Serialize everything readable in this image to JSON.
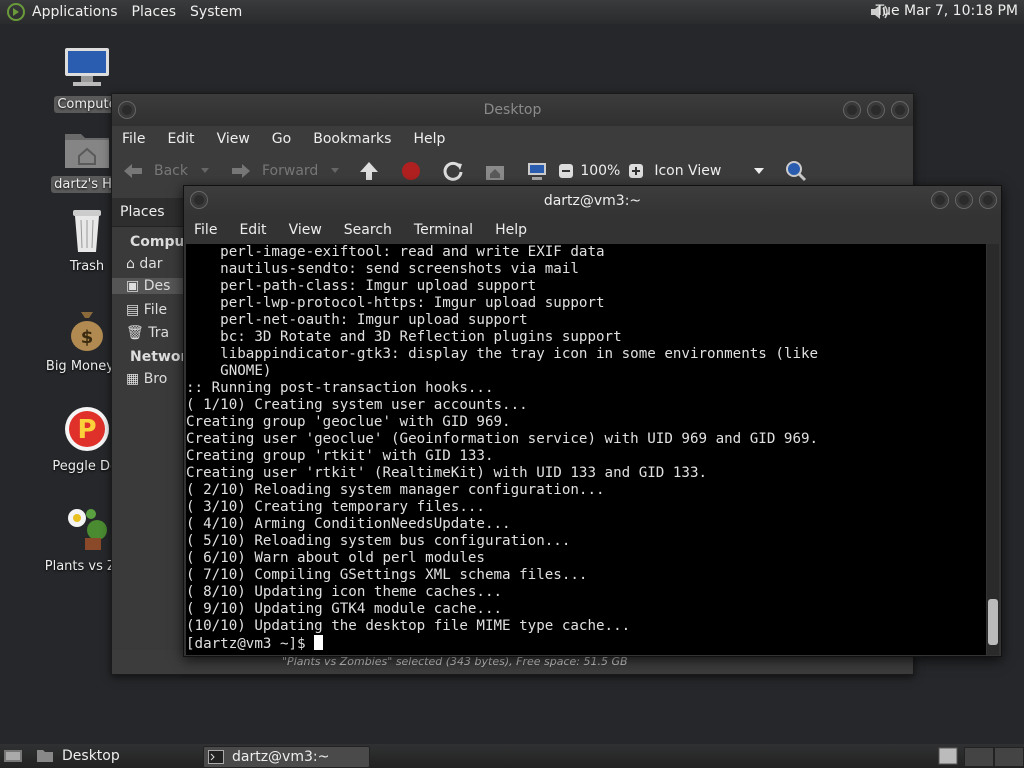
{
  "top_panel": {
    "menus": [
      "Applications",
      "Places",
      "System"
    ],
    "clock": "Tue Mar  7, 10:18 PM"
  },
  "desktop_icons": [
    {
      "label": "Compute",
      "icon": "computer-icon",
      "selected": true
    },
    {
      "label": "dartz's Ho",
      "icon": "home-folder-icon",
      "selected": true
    },
    {
      "label": "Trash",
      "icon": "trash-icon",
      "selected": false
    },
    {
      "label": "Big Money D",
      "icon": "money-bag-icon",
      "selected": false
    },
    {
      "label": "Peggle Del",
      "icon": "peggle-icon",
      "selected": false
    },
    {
      "label": "Plants vs Zor",
      "icon": "plants-vs-zombies-icon",
      "selected": false
    }
  ],
  "nautilus": {
    "title": "Desktop",
    "menus": [
      "File",
      "Edit",
      "View",
      "Go",
      "Bookmarks",
      "Help"
    ],
    "toolbar": {
      "back": "Back",
      "forward": "Forward",
      "zoom": "100%",
      "view_mode": "Icon View"
    },
    "places_label": "Places",
    "sidebar": {
      "computer_header": "Compute",
      "items": [
        "dar",
        "Des",
        "File",
        "Tra"
      ],
      "network_header": "Network",
      "network_items": [
        "Bro"
      ]
    },
    "status": "\"Plants vs Zombies\" selected (343 bytes), Free space: 51.5 GB"
  },
  "terminal": {
    "title": "dartz@vm3:~",
    "menus": [
      "File",
      "Edit",
      "View",
      "Search",
      "Terminal",
      "Help"
    ],
    "lines": [
      "    perl-image-exiftool: read and write EXIF data",
      "    nautilus-sendto: send screenshots via mail",
      "    perl-path-class: Imgur upload support",
      "    perl-lwp-protocol-https: Imgur upload support",
      "    perl-net-oauth: Imgur upload support",
      "    bc: 3D Rotate and 3D Reflection plugins support",
      "    libappindicator-gtk3: display the tray icon in some environments (like",
      "    GNOME)",
      ":: Running post-transaction hooks...",
      "( 1/10) Creating system user accounts...",
      "Creating group 'geoclue' with GID 969.",
      "Creating user 'geoclue' (Geoinformation service) with UID 969 and GID 969.",
      "Creating group 'rtkit' with GID 133.",
      "Creating user 'rtkit' (RealtimeKit) with UID 133 and GID 133.",
      "( 2/10) Reloading system manager configuration...",
      "( 3/10) Creating temporary files...",
      "( 4/10) Arming ConditionNeedsUpdate...",
      "( 5/10) Reloading system bus configuration...",
      "( 6/10) Warn about old perl modules",
      "( 7/10) Compiling GSettings XML schema files...",
      "( 8/10) Updating icon theme caches...",
      "( 9/10) Updating GTK4 module cache...",
      "(10/10) Updating the desktop file MIME type cache..."
    ],
    "prompt": "[dartz@vm3 ~]$ "
  },
  "bottom_panel": {
    "tasks": [
      {
        "label": "Desktop",
        "icon": "folder-icon",
        "active": false
      },
      {
        "label": "dartz@vm3:~",
        "icon": "terminal-icon",
        "active": true
      }
    ]
  }
}
